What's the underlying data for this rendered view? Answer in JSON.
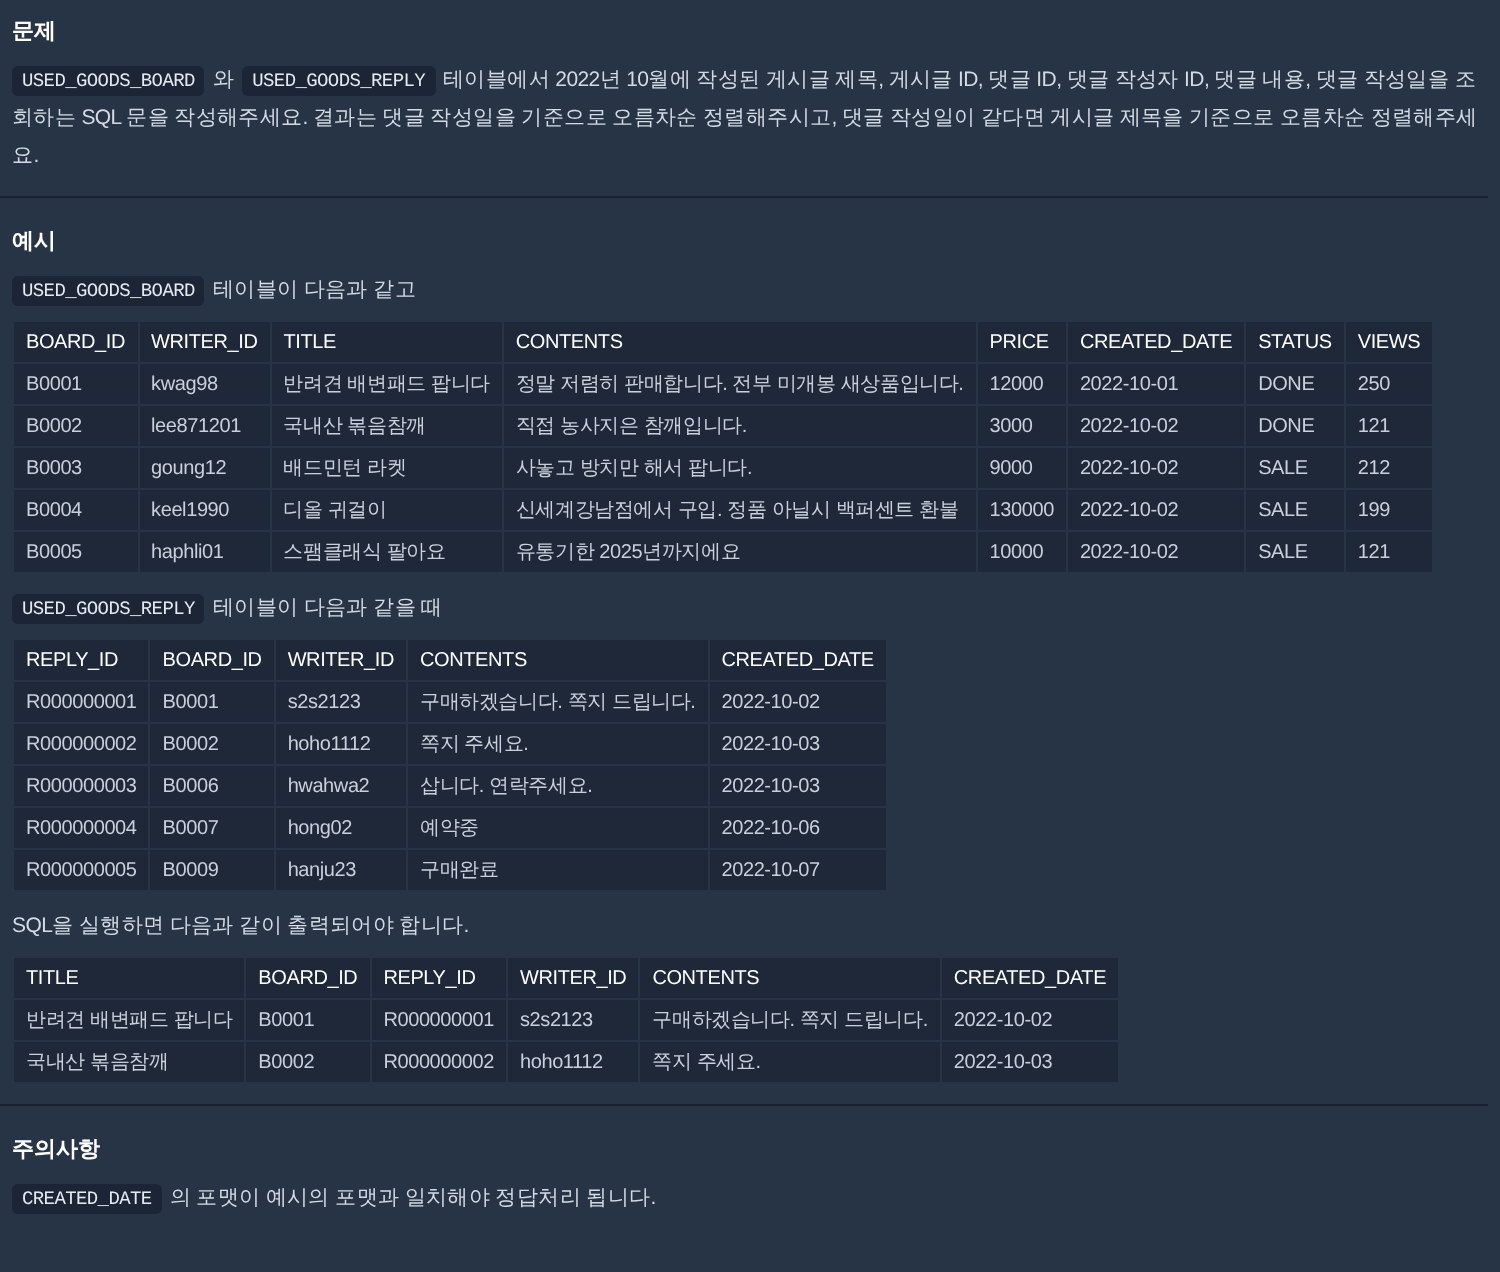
{
  "sections": [
    {
      "heading": "문제",
      "blocks": [
        {
          "kind": "paragraph",
          "segments": [
            {
              "kind": "code",
              "text": "USED_GOODS_BOARD"
            },
            {
              "kind": "text",
              "text": "와"
            },
            {
              "kind": "code",
              "text": "USED_GOODS_REPLY"
            },
            {
              "kind": "text",
              "text": "테이블에서 2022년 10월에 작성된 게시글 제목, 게시글 ID, 댓글 ID, 댓글 작성자 ID, 댓글 내용, 댓글 작성일을 조회하는 SQL 문을 작성해주세요. 결과는 댓글 작성일을 기준으로 오름차순 정렬해주시고, 댓글 작성일이 같다면 게시글 제목을 기준으로 오름차순 정렬해주세요."
            }
          ]
        }
      ]
    },
    {
      "heading": "예시",
      "blocks": [
        {
          "kind": "paragraph",
          "segments": [
            {
              "kind": "code",
              "text": "USED_GOODS_BOARD"
            },
            {
              "kind": "text",
              "text": "테이블이 다음과 같고"
            }
          ]
        },
        {
          "kind": "table",
          "columns": [
            "BOARD_ID",
            "WRITER_ID",
            "TITLE",
            "CONTENTS",
            "PRICE",
            "CREATED_DATE",
            "STATUS",
            "VIEWS"
          ],
          "rows": [
            [
              "B0001",
              "kwag98",
              "반려견 배변패드 팝니다",
              "정말 저렴히 판매합니다. 전부 미개봉 새상품입니다.",
              "12000",
              "2022-10-01",
              "DONE",
              "250"
            ],
            [
              "B0002",
              "lee871201",
              "국내산 볶음참깨",
              "직접 농사지은 참깨입니다.",
              "3000",
              "2022-10-02",
              "DONE",
              "121"
            ],
            [
              "B0003",
              "goung12",
              "배드민턴 라켓",
              "사놓고 방치만 해서 팝니다.",
              "9000",
              "2022-10-02",
              "SALE",
              "212"
            ],
            [
              "B0004",
              "keel1990",
              "디올 귀걸이",
              "신세계강남점에서 구입. 정품 아닐시 백퍼센트 환불",
              "130000",
              "2022-10-02",
              "SALE",
              "199"
            ],
            [
              "B0005",
              "haphli01",
              "스팸클래식 팔아요",
              "유통기한 2025년까지에요",
              "10000",
              "2022-10-02",
              "SALE",
              "121"
            ]
          ]
        },
        {
          "kind": "paragraph",
          "segments": [
            {
              "kind": "code",
              "text": "USED_GOODS_REPLY"
            },
            {
              "kind": "text",
              "text": "테이블이 다음과 같을 때"
            }
          ]
        },
        {
          "kind": "table",
          "columns": [
            "REPLY_ID",
            "BOARD_ID",
            "WRITER_ID",
            "CONTENTS",
            "CREATED_DATE"
          ],
          "rows": [
            [
              "R000000001",
              "B0001",
              "s2s2123",
              "구매하겠습니다. 쪽지 드립니다.",
              "2022-10-02"
            ],
            [
              "R000000002",
              "B0002",
              "hoho1112",
              "쪽지 주세요.",
              "2022-10-03"
            ],
            [
              "R000000003",
              "B0006",
              "hwahwa2",
              "삽니다. 연락주세요.",
              "2022-10-03"
            ],
            [
              "R000000004",
              "B0007",
              "hong02",
              "예약중",
              "2022-10-06"
            ],
            [
              "R000000005",
              "B0009",
              "hanju23",
              "구매완료",
              "2022-10-07"
            ]
          ]
        },
        {
          "kind": "paragraph",
          "segments": [
            {
              "kind": "text",
              "text": "SQL을 실행하면 다음과 같이 출력되어야 합니다."
            }
          ]
        },
        {
          "kind": "table",
          "columns": [
            "TITLE",
            "BOARD_ID",
            "REPLY_ID",
            "WRITER_ID",
            "CONTENTS",
            "CREATED_DATE"
          ],
          "rows": [
            [
              "반려견 배변패드 팝니다",
              "B0001",
              "R000000001",
              "s2s2123",
              "구매하겠습니다. 쪽지 드립니다.",
              "2022-10-02"
            ],
            [
              "국내산 볶음참깨",
              "B0002",
              "R000000002",
              "hoho1112",
              "쪽지 주세요.",
              "2022-10-03"
            ]
          ]
        }
      ]
    },
    {
      "heading": "주의사항",
      "blocks": [
        {
          "kind": "paragraph",
          "segments": [
            {
              "kind": "code",
              "text": "CREATED_DATE"
            },
            {
              "kind": "text",
              "text": "의 포맷이 예시의 포맷과 일치해야 정답처리 됩니다."
            }
          ]
        }
      ]
    }
  ]
}
